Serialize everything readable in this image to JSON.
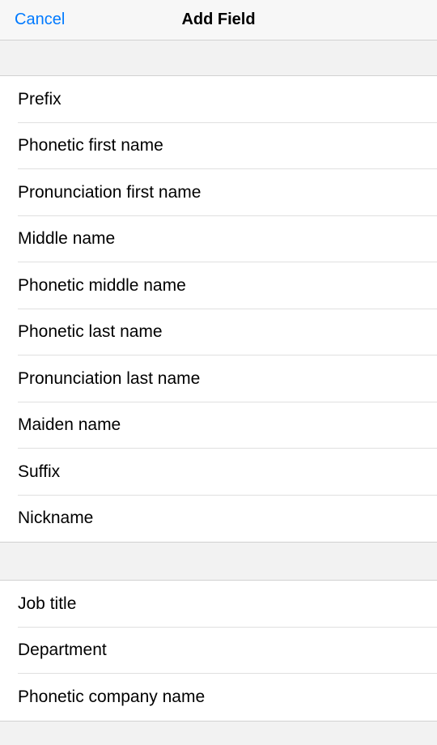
{
  "nav": {
    "cancel": "Cancel",
    "title": "Add Field"
  },
  "sections": {
    "name_fields": [
      "Prefix",
      "Phonetic first name",
      "Pronunciation first name",
      "Middle name",
      "Phonetic middle name",
      "Phonetic last name",
      "Pronunciation last name",
      "Maiden name",
      "Suffix",
      "Nickname"
    ],
    "work_fields": [
      "Job title",
      "Department",
      "Phonetic company name"
    ]
  }
}
